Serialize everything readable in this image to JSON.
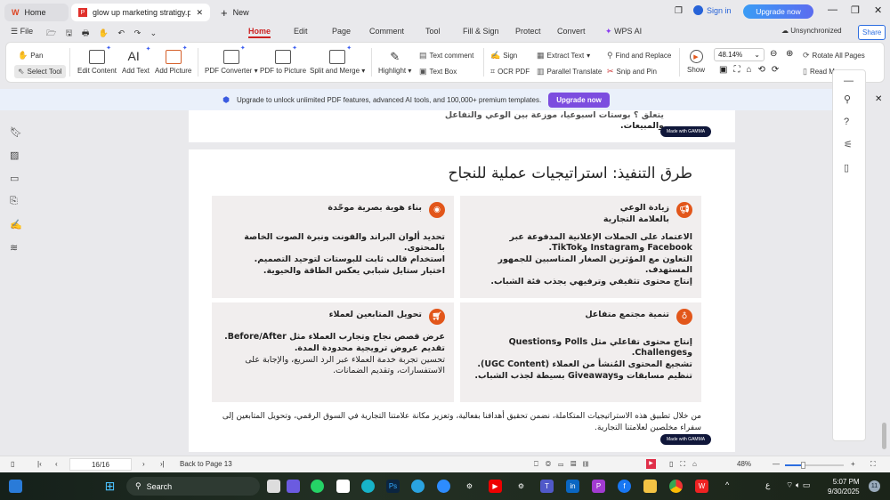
{
  "tabs": {
    "home": "Home",
    "doc": "glow up marketing stratigy.p",
    "new": "New"
  },
  "titlebar": {
    "sign_in": "Sign in",
    "upgrade": "Upgrade now"
  },
  "menu": {
    "file": "File",
    "items": [
      "Home",
      "Edit",
      "Page",
      "Comment",
      "Tool",
      "Fill & Sign",
      "Protect",
      "Convert",
      "WPS AI"
    ],
    "active": "Home",
    "unsync": "Unsynchronized",
    "share": "Share"
  },
  "ribbon": {
    "pan": "Pan",
    "select": "Select Tool",
    "edit_content": "Edit Content",
    "add_text": "Add Text",
    "add_picture": "Add Picture",
    "pdf_converter": "PDF Converter",
    "pdf_to_picture": "PDF to Picture",
    "split_merge": "Split and Merge",
    "highlight": "Highlight",
    "text_comment": "Text comment",
    "text_box": "Text Box",
    "sign": "Sign",
    "ocr": "OCR PDF",
    "extract": "Extract Text",
    "parallel": "Parallel Translate",
    "find": "Find and Replace",
    "snip": "Snip and Pin",
    "show": "Show",
    "zoom": "48.14%",
    "rotate": "Rotate All Pages",
    "read": "Read M"
  },
  "banner": {
    "text": "Upgrade to unlock unlimited PDF features, advanced AI tools, and 100,000+ premium templates.",
    "button": "Upgrade now"
  },
  "page_prev": {
    "line1": "يتعلق ؟ بوستات اسبوعيا، موزعة بين الوعي والتفاعل",
    "line2": "والمبيعات."
  },
  "gamma": "Made with GAMMA",
  "slide": {
    "title": "طرق التنفيذ: استراتيجيات عملية للنجاح",
    "cards": [
      {
        "title": "زيادة الوعي بالعلامة التجارية",
        "icon": "megaphone-icon",
        "items": [
          "الاعتماد على الحملات الإعلانية المدفوعة عبر Facebook وInstagram وTikTok.",
          "التعاون مع المؤثرين الصغار المناسبين للجمهور المستهدف.",
          "إنتاج محتوى تثقيفي وترفيهي يجذب فئة الشباب."
        ]
      },
      {
        "title": "بناء هوية بصرية موحّدة",
        "icon": "palette-icon",
        "items": [
          "تحديد ألوان البراند والفونت ونبرة الصوت الخاصة بالمحتوى.",
          "استخدام قالب ثابت للبوستات لتوحيد التصميم.",
          "اختيار ستايل شبابي يعكس الطاقة والحيوية."
        ]
      },
      {
        "title": "تنمية مجتمع متفاعل",
        "icon": "community-icon",
        "items": [
          "إنتاج محتوى تفاعلي مثل Polls وQuestions وChallenges.",
          "تشجيع المحتوى المُنشأ من العملاء (UGC Content).",
          "تنظيم مسابقات وGiveaways بسيطة لجذب الشباب."
        ]
      },
      {
        "title": "تحويل المتابعين لعملاء",
        "icon": "cart-icon",
        "items": [
          "عرض قصص نجاح وتجارب العملاء مثل Before/After.",
          "تقديم عروض ترويجية محدودة المدة.",
          "تحسين تجربة خدمة العملاء عبر الرد السريع، والإجابة على الاستفسارات، وتقديم الضمانات."
        ]
      }
    ],
    "conclusion": "من خلال تطبيق هذه الاستراتيجيات المتكاملة، نضمن تحقيق أهدافنا بفعالية، وتعزيز مكانة علامتنا التجارية في السوق الرقمي، وتحويل المتابعين إلى سفراء مخلصين لعلامتنا التجارية."
  },
  "status": {
    "page": "16/16",
    "back": "Back to Page 13",
    "zoom": "48%",
    "slider_percent": 48
  },
  "taskbar": {
    "search": "Search",
    "time": "5:07 PM",
    "date": "9/30/2025",
    "lang": "ع",
    "badge": "11"
  }
}
